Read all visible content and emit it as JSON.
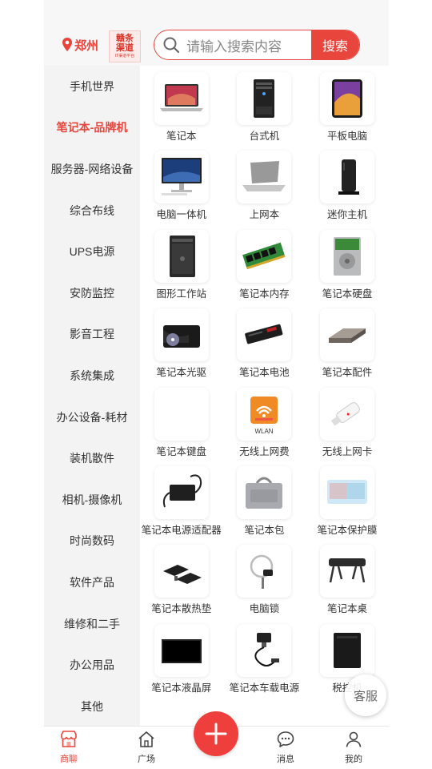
{
  "header": {
    "location": "郑州",
    "logo_line1": "赣条",
    "logo_line2": "渠道",
    "logo_line3": "IT渠道平台",
    "search_placeholder": "请输入搜索内容",
    "search_button": "搜索"
  },
  "sidebar": {
    "items": [
      {
        "label": "手机世界"
      },
      {
        "label": "笔记本-品牌机",
        "active": true
      },
      {
        "label": "服务器-网络设备"
      },
      {
        "label": "综合布线"
      },
      {
        "label": "UPS电源"
      },
      {
        "label": "安防监控"
      },
      {
        "label": "影音工程"
      },
      {
        "label": "系统集成"
      },
      {
        "label": "办公设备-耗材"
      },
      {
        "label": "装机散件"
      },
      {
        "label": "相机-摄像机"
      },
      {
        "label": "时尚数码"
      },
      {
        "label": "软件产品"
      },
      {
        "label": "维修和二手"
      },
      {
        "label": "办公用品"
      },
      {
        "label": "其他"
      }
    ]
  },
  "products": [
    {
      "label": "笔记本",
      "icon": "laptop-icon"
    },
    {
      "label": "台式机",
      "icon": "desktop-tower-icon"
    },
    {
      "label": "平板电脑",
      "icon": "tablet-icon"
    },
    {
      "label": "电脑一体机",
      "icon": "all-in-one-icon"
    },
    {
      "label": "上网本",
      "icon": "netbook-icon"
    },
    {
      "label": "迷你主机",
      "icon": "mini-pc-icon"
    },
    {
      "label": "图形工作站",
      "icon": "workstation-icon"
    },
    {
      "label": "笔记本内存",
      "icon": "ram-icon"
    },
    {
      "label": "笔记本硬盘",
      "icon": "hard-drive-icon"
    },
    {
      "label": "笔记本光驱",
      "icon": "optical-drive-icon"
    },
    {
      "label": "笔记本电池",
      "icon": "battery-icon"
    },
    {
      "label": "笔记本配件",
      "icon": "accessory-icon"
    },
    {
      "label": "笔记本键盘",
      "icon": "keyboard-icon"
    },
    {
      "label": "无线上网费",
      "icon": "wlan-icon",
      "badge": "WLAN"
    },
    {
      "label": "无线上网卡",
      "icon": "usb-modem-icon"
    },
    {
      "label": "笔记本电源适配器",
      "icon": "power-adapter-icon"
    },
    {
      "label": "笔记本包",
      "icon": "laptop-bag-icon"
    },
    {
      "label": "笔记本保护膜",
      "icon": "keyboard-film-icon"
    },
    {
      "label": "笔记本散热垫",
      "icon": "cooling-pad-icon"
    },
    {
      "label": "电脑锁",
      "icon": "cable-lock-icon"
    },
    {
      "label": "笔记本桌",
      "icon": "laptop-desk-icon"
    },
    {
      "label": "笔记本液晶屏",
      "icon": "lcd-panel-icon"
    },
    {
      "label": "笔记本车载电源",
      "icon": "car-charger-icon"
    },
    {
      "label": "税控机",
      "icon": "tax-device-icon"
    }
  ],
  "float_service": "客服",
  "bottom_nav": {
    "tabs": [
      {
        "label": "商聊",
        "icon": "shop-icon",
        "active": true
      },
      {
        "label": "广场",
        "icon": "home-icon"
      },
      {
        "label": "消息",
        "icon": "message-icon"
      },
      {
        "label": "我的",
        "icon": "user-icon"
      }
    ],
    "center_icon": "plus-icon"
  },
  "colors": {
    "accent": "#e8453c",
    "sidebar_bg": "#f3f3f3",
    "header_bg": "#f7f7f7"
  }
}
